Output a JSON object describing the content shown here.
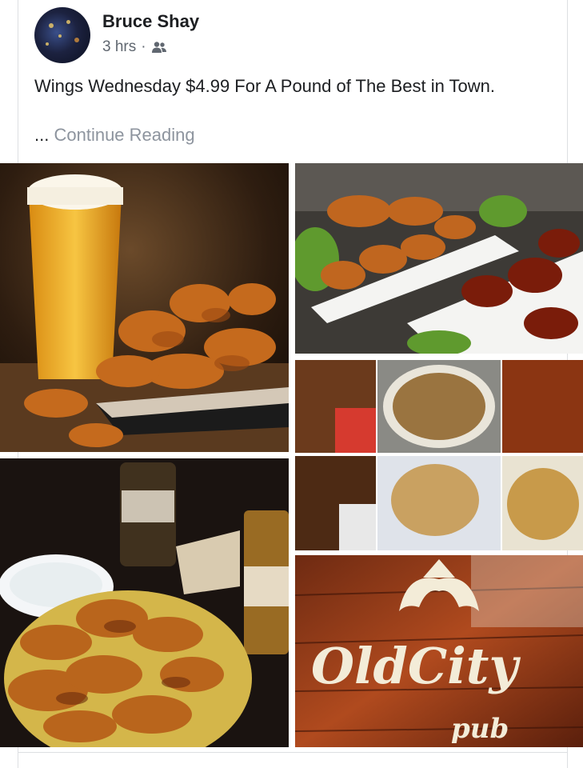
{
  "post": {
    "author": "Bruce Shay",
    "time": "3 hrs",
    "dot": "·",
    "audience_icon": "friends-icon",
    "text": "Wings Wednesday $4.99 For A Pound of The Best in Town.",
    "ellipsis": "...",
    "continue_label": "Continue Reading"
  },
  "photos": [
    {
      "name": "beer-and-wings-photo"
    },
    {
      "name": "wing-platters-photo"
    },
    {
      "name": "wing-collage-photo"
    },
    {
      "name": "wings-with-dip-photo"
    },
    {
      "name": "old-city-pub-logo-photo"
    }
  ],
  "logo": {
    "line1": "OldCity",
    "line2": "pub"
  },
  "colors": {
    "text": "#1c1e21",
    "meta": "#606770",
    "link": "#8d949e",
    "border": "#dddfe2"
  }
}
